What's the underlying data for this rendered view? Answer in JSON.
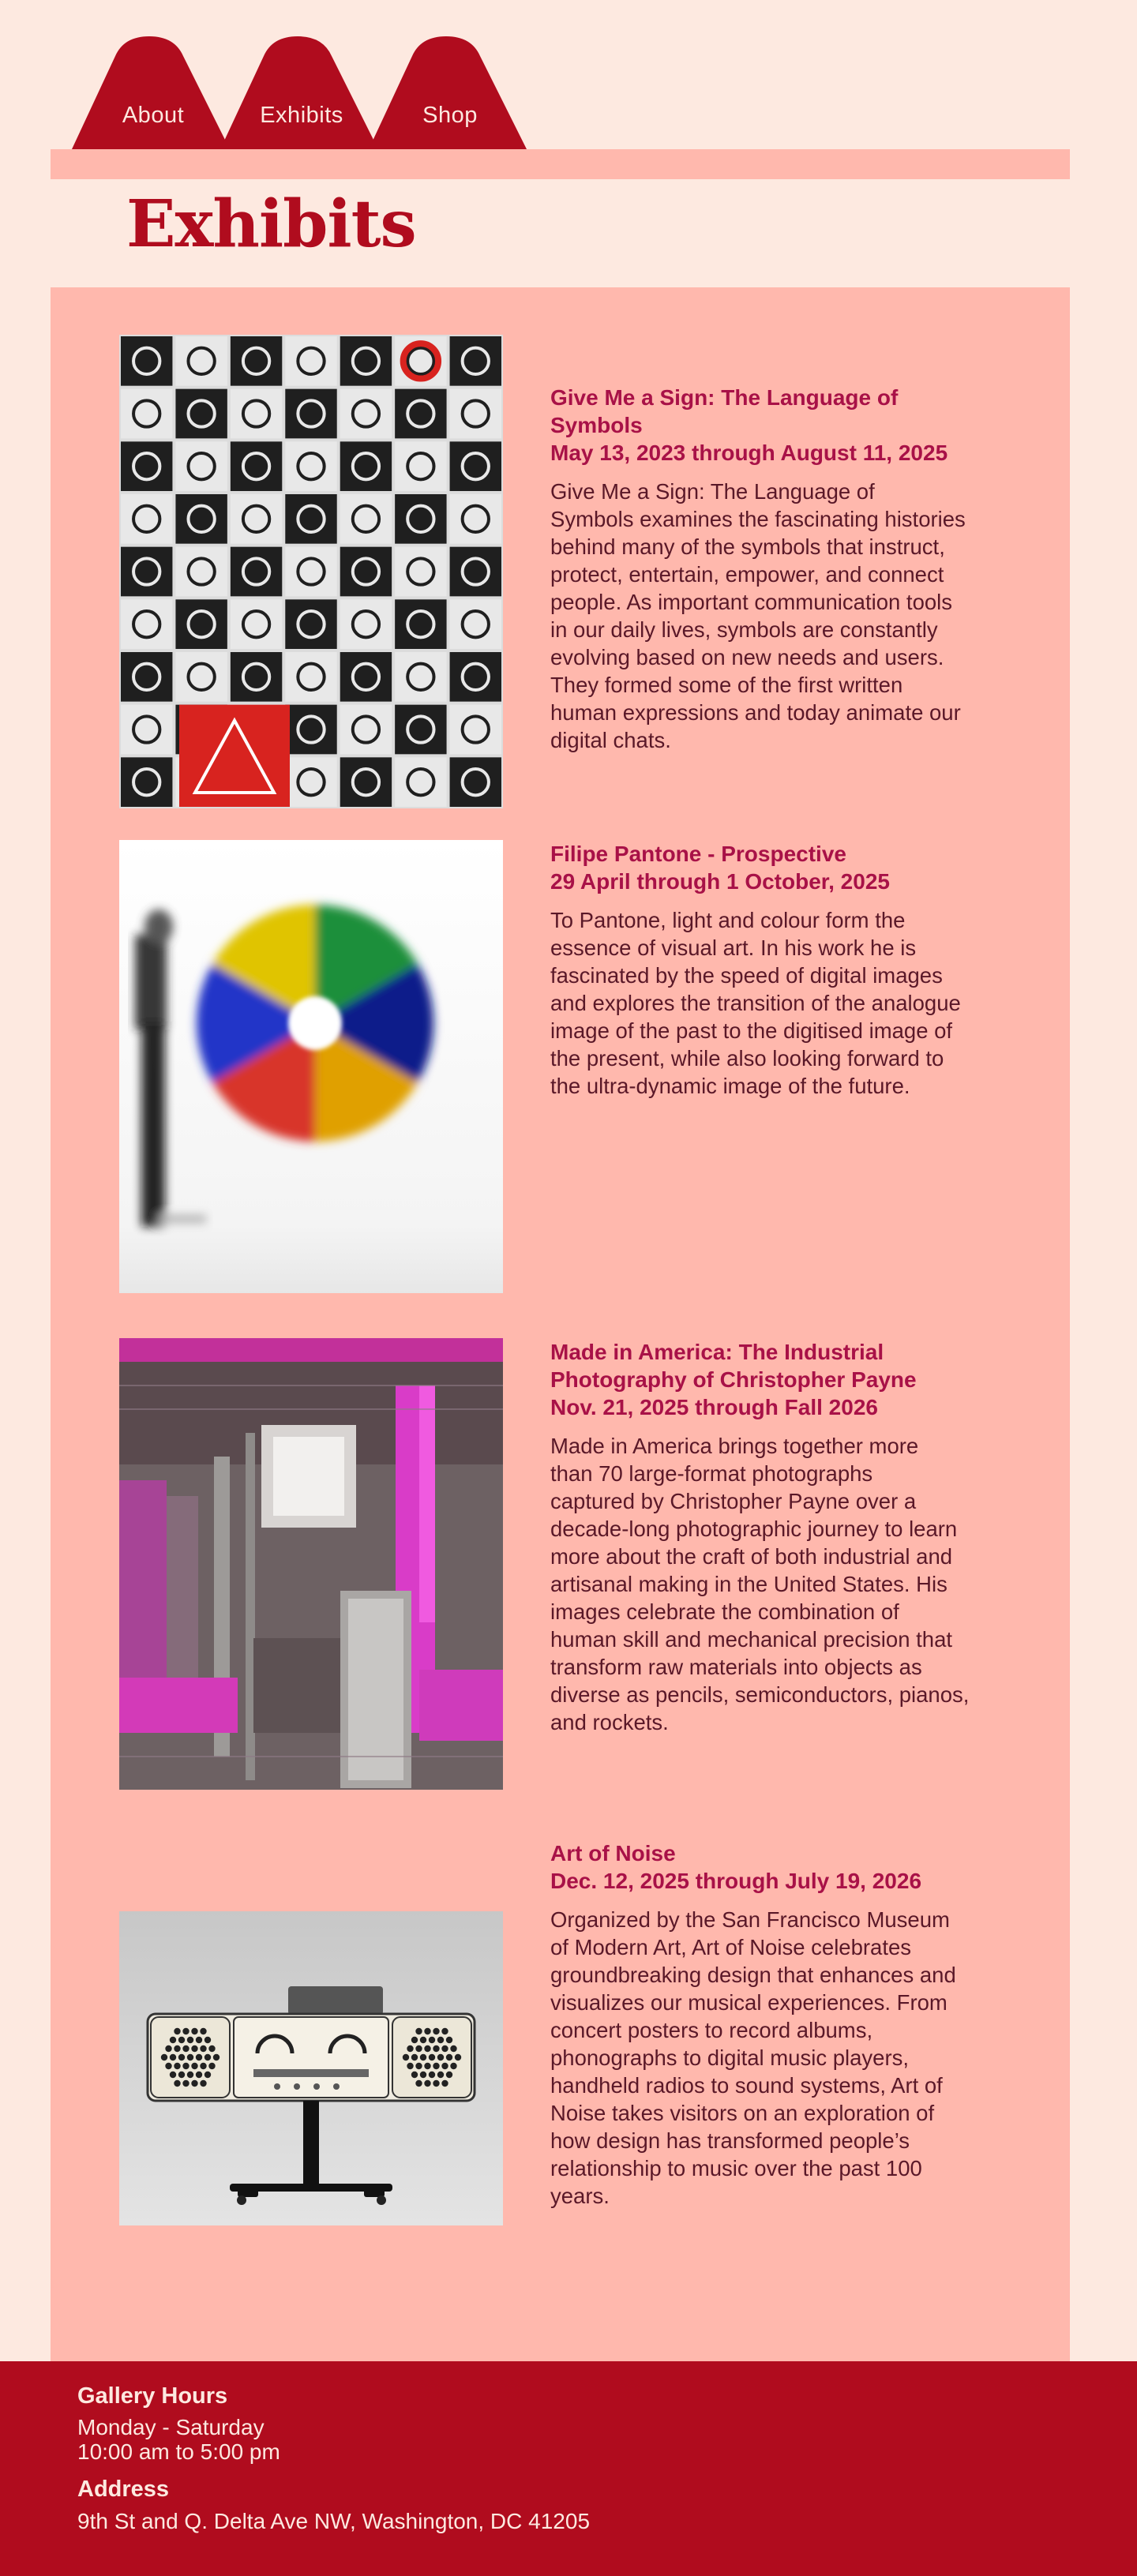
{
  "nav": {
    "tabs": [
      {
        "label": "About"
      },
      {
        "label": "Exhibits"
      },
      {
        "label": "Shop"
      }
    ]
  },
  "page": {
    "title": "Exhibits"
  },
  "colors": {
    "background": "#fde9e0",
    "panel": "#ffb8ad",
    "accent": "#b00c1e",
    "title_text": "#a81147",
    "body_text": "#5a1828"
  },
  "exhibits": [
    {
      "title_lines": [
        "Give Me a Sign: The Language of",
        "Symbols"
      ],
      "date": "May 13, 2023 through August 11, 2025",
      "desc_lines": [
        "Give Me a Sign: The Language of",
        "Symbols examines the fascinating histories",
        "behind many of the symbols that instruct,",
        "protect, entertain, empower, and connect",
        "people. As important communication tools",
        "in our daily lives, symbols are constantly",
        "evolving based on new needs and users.",
        "They formed some of the first written",
        "human expressions and today animate our",
        "digital chats."
      ],
      "image_icon": "symbol-grid-image"
    },
    {
      "title_lines": [
        "Filipe Pantone - Prospective"
      ],
      "date": "29 April through 1 October, 2025",
      "desc_lines": [
        "To Pantone, light and colour form the",
        "essence of visual art. In his work he is",
        "fascinated by the speed of digital images",
        "and explores the transition of the analogue",
        "image of the past to the digitised image of",
        "the present, while also looking forward to",
        "the ultra-dynamic image of the future."
      ],
      "image_icon": "color-disc-image"
    },
    {
      "title_lines": [
        "Made in America: The Industrial",
        "Photography of Christopher Payne"
      ],
      "date": "Nov. 21, 2025 through Fall 2026",
      "desc_lines": [
        "Made in America brings together more",
        "than 70 large-format photographs",
        "captured by Christopher Payne over a",
        "decade-long photographic journey to learn",
        "more about the craft of both industrial and",
        "artisanal making in the United States. His",
        "images celebrate the combination of",
        "human skill and mechanical precision that",
        "transform raw materials into objects as",
        "diverse as pencils, semiconductors, pianos,",
        "and rockets."
      ],
      "image_icon": "factory-image"
    },
    {
      "title_lines": [
        "Art of Noise"
      ],
      "date": "Dec. 12, 2025 through July 19, 2026",
      "desc_lines": [
        "Organized by the San Francisco Museum",
        "of Modern Art, Art of Noise celebrates",
        "groundbreaking design that enhances and",
        "visualizes our musical experiences. From",
        "concert posters to record albums,",
        "phonographs to digital music players,",
        "handheld radios to sound systems, Art of",
        "Noise takes visitors on an exploration of",
        "how design has transformed people’s",
        "relationship to music over the past 100",
        "years."
      ],
      "image_icon": "radio-image"
    }
  ],
  "footer": {
    "hours_heading": "Gallery Hours",
    "days": "Monday - Saturday",
    "hours": "10:00 am to 5:00 pm",
    "address_heading": "Address",
    "address": "9th St and Q. Delta Ave NW, Washington, DC 41205"
  }
}
